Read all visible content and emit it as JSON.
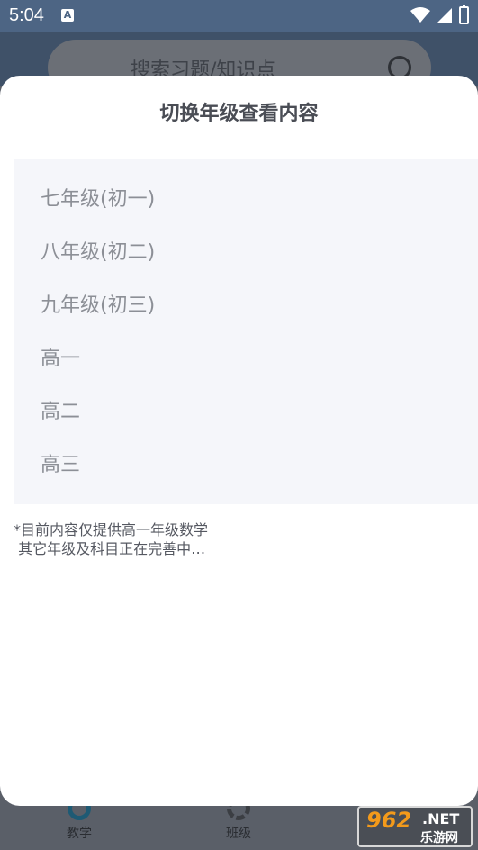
{
  "status_bar": {
    "time": "5:04",
    "notification_icon": "A"
  },
  "background": {
    "search_placeholder": "搜索习题/知识点",
    "nav": [
      {
        "label": "教学"
      },
      {
        "label": "班级"
      }
    ],
    "watermark": {
      "number": "962",
      "suffix": ".NET",
      "chinese": "乐游网"
    }
  },
  "sheet": {
    "title": "切换年级查看内容",
    "grades": [
      {
        "label": "七年级(初一)"
      },
      {
        "label": "八年级(初二)"
      },
      {
        "label": "九年级(初三)"
      },
      {
        "label": "高一"
      },
      {
        "label": "高二"
      },
      {
        "label": "高三"
      }
    ],
    "note": "*目前内容仅提供高一年级数学\n 其它年级及科目正在完善中…"
  },
  "colors": {
    "status_bar": "#4d6584",
    "sheet_bg": "#ffffff",
    "grade_box_bg": "#f5f6fa",
    "grade_text": "#8c8f96",
    "title_text": "#4a4d55",
    "nav_active": "#1e5a74"
  }
}
